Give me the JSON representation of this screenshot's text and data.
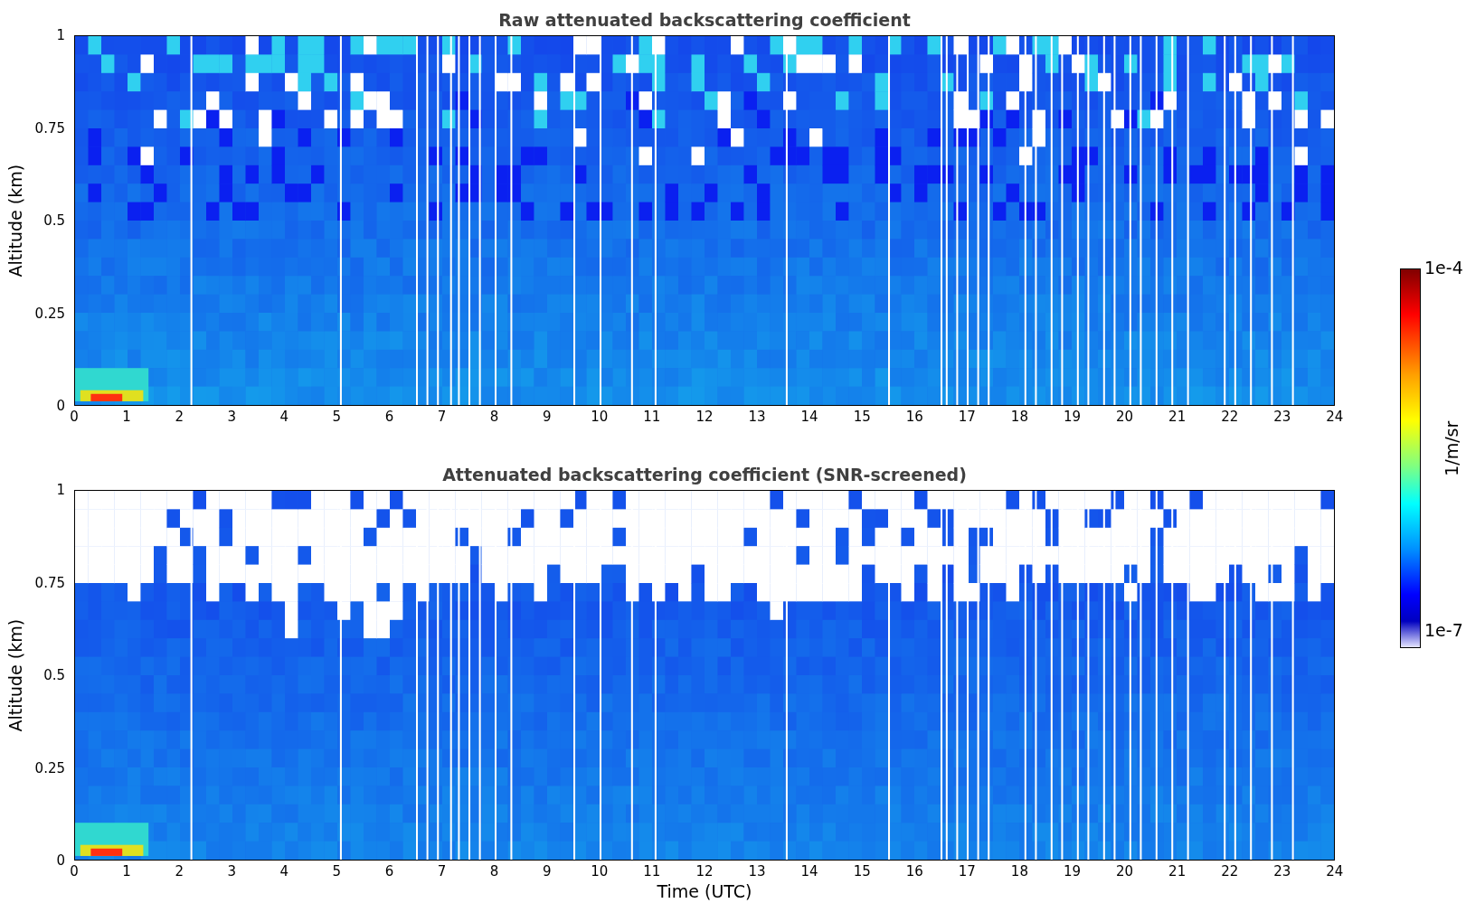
{
  "plots": [
    {
      "kind": "raw",
      "title": "Raw attenuated backscattering coefficient",
      "ylabel": "Altitude (km)",
      "yticks": [
        "1",
        "0.75",
        "0.5",
        "0.25",
        "0"
      ],
      "xticks": [
        "0",
        "1",
        "2",
        "3",
        "4",
        "5",
        "6",
        "7",
        "8",
        "9",
        "10",
        "11",
        "12",
        "13",
        "14",
        "15",
        "16",
        "17",
        "18",
        "19",
        "20",
        "21",
        "22",
        "23",
        "24"
      ]
    },
    {
      "kind": "screened",
      "title": "Attenuated backscattering coefficient (SNR-screened)",
      "ylabel": "Altitude (km)",
      "yticks": [
        "1",
        "0.75",
        "0.5",
        "0.25",
        "0"
      ],
      "xticks": [
        "0",
        "1",
        "2",
        "3",
        "4",
        "5",
        "6",
        "7",
        "8",
        "9",
        "10",
        "11",
        "12",
        "13",
        "14",
        "15",
        "16",
        "17",
        "18",
        "19",
        "20",
        "21",
        "22",
        "23",
        "24"
      ],
      "xlabel": "Time (UTC)"
    }
  ],
  "colorbar": {
    "max": "1e-4",
    "min": "1e-7",
    "label": "1/m/sr"
  }
}
